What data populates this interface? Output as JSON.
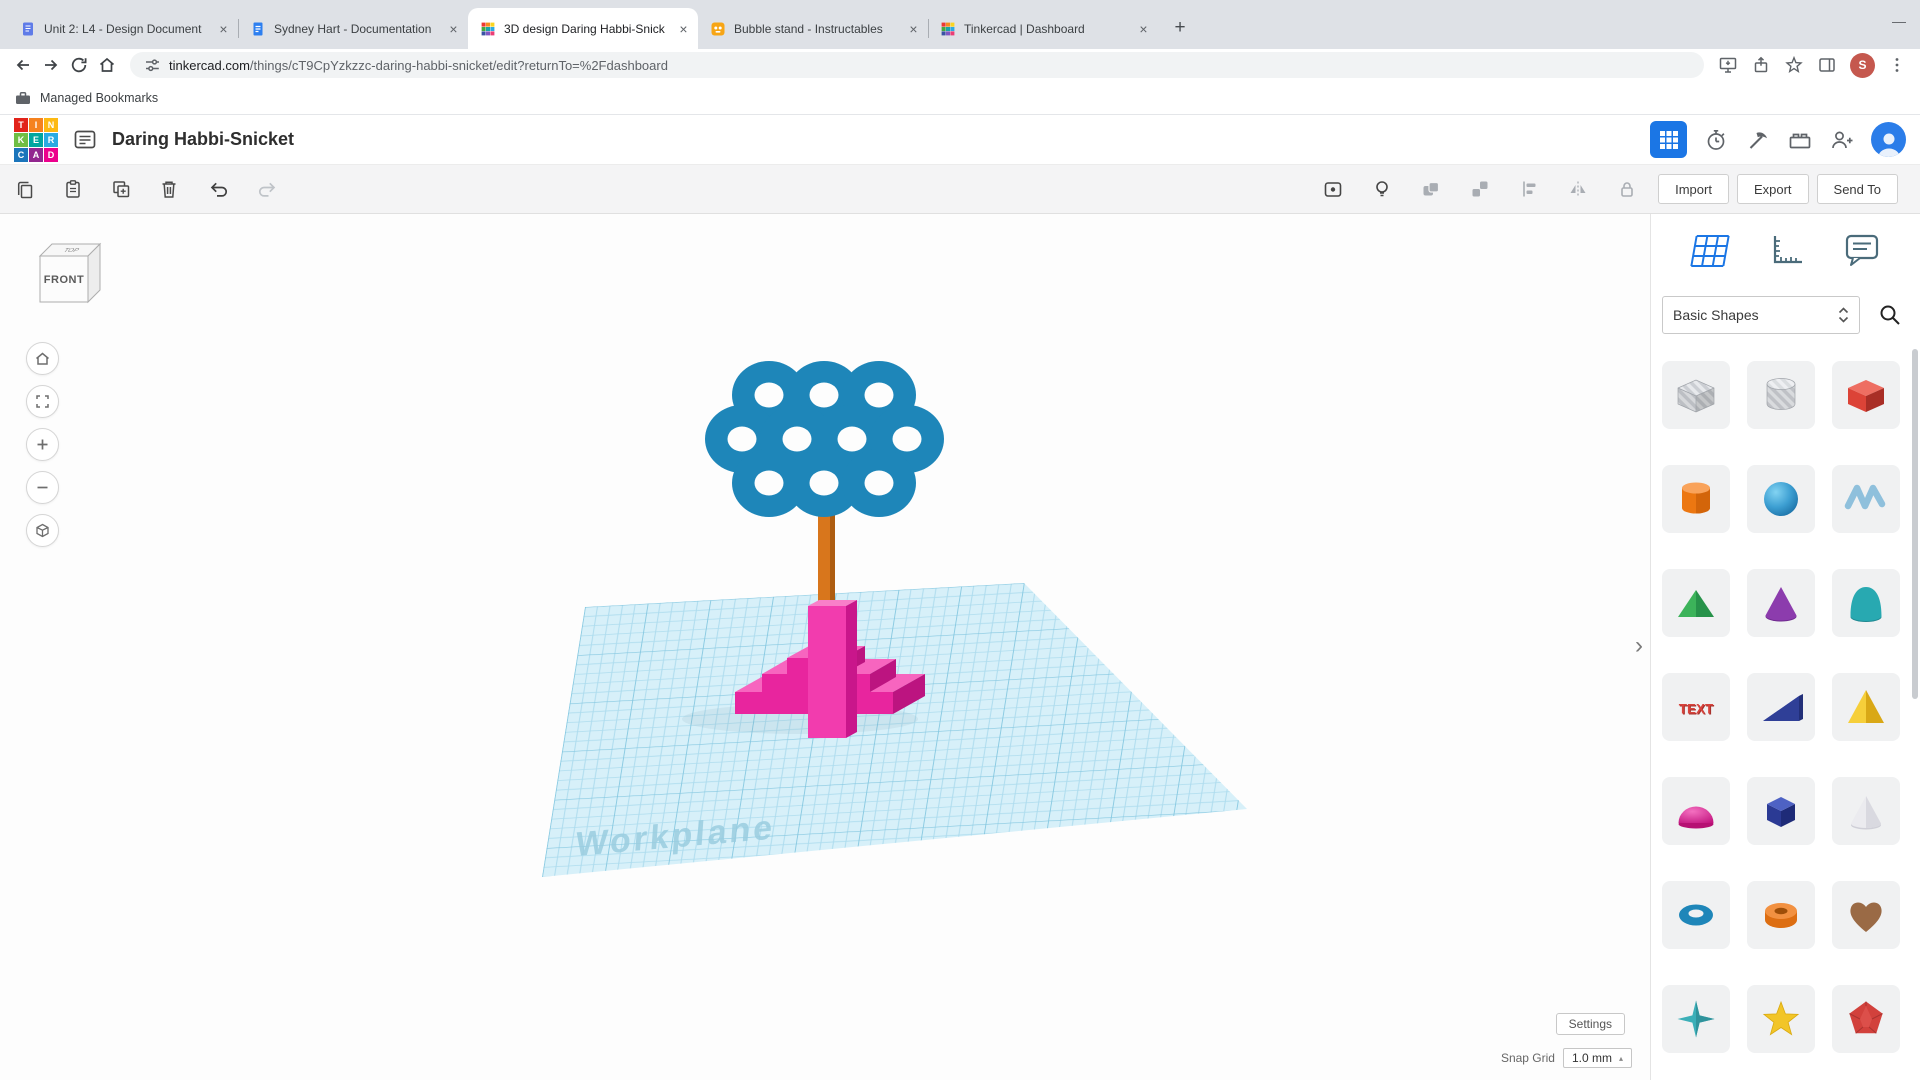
{
  "colors": {
    "accent_blue": "#1B76E5",
    "workplane_fill": "#D7F0F9",
    "ring_blue": "#1E86B9",
    "trunk_orange": "#D8761C",
    "base_pink": "#EA28A2"
  },
  "browser": {
    "tabs": [
      {
        "title": "Unit 2: L4 - Design Document"
      },
      {
        "title": "Sydney Hart - Documentation"
      },
      {
        "title": "3D design Daring Habbi-Snick"
      },
      {
        "title": "Bubble stand - Instructables"
      },
      {
        "title": "Tinkercad | Dashboard"
      }
    ],
    "url": {
      "domain": "tinkercad.com",
      "path": "/things/cT9CpYzkzzc-daring-habbi-snicket/edit?returnTo=%2Fdashboard"
    },
    "bookmarks_label": "Managed Bookmarks",
    "profile_initial": "S"
  },
  "header": {
    "title": "Daring Habbi-Snicket",
    "logo_letters": [
      "T",
      "I",
      "N",
      "K",
      "E",
      "R",
      "C",
      "A",
      "D"
    ]
  },
  "toolbar": {
    "import_label": "Import",
    "export_label": "Export",
    "send_to_label": "Send To"
  },
  "panel": {
    "dropdown_label": "Basic Shapes",
    "text_shape_label": "TEXT",
    "shape_names": [
      "box-hole",
      "cylinder-hole",
      "box",
      "cylinder",
      "sphere",
      "scribble",
      "roof",
      "cone",
      "paraboloid",
      "text",
      "wedge",
      "pyramid",
      "half-sphere",
      "polygon",
      "cone-white",
      "torus",
      "tube",
      "heart",
      "star-4",
      "star-5",
      "polyhedron"
    ]
  },
  "canvas": {
    "workplane_label": "Workplane",
    "viewcube_front": "FRONT",
    "viewcube_top": "TOP"
  },
  "footer": {
    "settings_label": "Settings",
    "snap_label": "Snap Grid",
    "snap_value": "1.0 mm"
  }
}
